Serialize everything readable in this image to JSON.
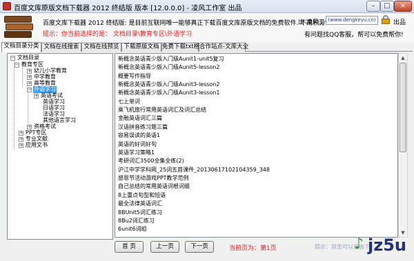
{
  "window": {
    "title": "百度文库原版文档下载器 2012 终结版    版本 [12.0.0.0]  - 凌风工作室 出品",
    "buttons": {
      "minimize": "–",
      "maximize": "□",
      "close": "×"
    }
  },
  "header": {
    "intro": "百度文库下载器 2012 终结版: 是目前互联网唯一能够真正下载百度文库原版文档的免费软件. 不用积分!",
    "hint_prefix": "提示：你当前选择的是：",
    "hint_value": "文档目录\\教育专区\\外语学习",
    "author": "出 凌风工作室",
    "url": "(www.dengkeyu.cn)",
    "exit": "出品",
    "problem": "有问题找QQ客服，帮可以免费帮你!"
  },
  "tabs": [
    "文档目录分类",
    "文档在线搜索",
    "文档在线预览",
    "下载原版文档",
    "免费下载txt格式",
    "合作站点-文库大全"
  ],
  "active_tab": 0,
  "tree": {
    "root": "文档目录",
    "nodes": [
      {
        "label": "文档目录",
        "expander": "−"
      },
      {
        "label": "教育专区",
        "expander": "−"
      },
      {
        "label": "幼儿小学教育",
        "expander": "+"
      },
      {
        "label": "中学教育",
        "expander": "+"
      },
      {
        "label": "高等教育",
        "expander": "+"
      },
      {
        "label": "外语学习",
        "expander": "−",
        "selected": true
      },
      {
        "label": "英语考试",
        "expander": "+"
      },
      {
        "label": "英语学习",
        "expander": ""
      },
      {
        "label": "日语学习",
        "expander": ""
      },
      {
        "label": "法语学习",
        "expander": ""
      },
      {
        "label": "其他语言学习",
        "expander": ""
      },
      {
        "label": "资格考试",
        "expander": "+"
      },
      {
        "label": "PPT专区",
        "expander": "+"
      },
      {
        "label": "专业文献",
        "expander": "+"
      },
      {
        "label": "应用文书",
        "expander": "+"
      }
    ]
  },
  "list": {
    "items": [
      "新概念英语青少版入门级Aunit1-unit5复习",
      "新概念英语青少版入门级Aunit5-lesson2",
      "概要写作指导",
      "新概念英语青少版入门级Aunit3-lesson2",
      "新概念英语青少版入门级Aunit3-lesson1",
      "七上单词",
      "乘飞机旅行常用英语词汇及词汇总结",
      "金融英语词汇三篇",
      "汉语拼音练习题三篇",
      "容易误读的英语1",
      "英语的好词好句",
      "英语学习策略1",
      "考研词汇3500全集全练(2)",
      "沪江中学学科网_25词五首课件_20130617102104359_348",
      "感恩节活动游戏PPT教学范例",
      "自己总结的常用英语词根词缀",
      "8上重点句型和短语",
      "最全法律英语词汇",
      "8BUnit5词汇练习",
      "8Bu2词汇练习",
      "6unit6词组"
    ]
  },
  "pager": {
    "first": "首  页",
    "prev": "上一页",
    "next": "下一页",
    "page_info": "当前页为：第1页",
    "status": "提示：双击可以自由下"
  },
  "watermark": {
    "glyph": "♪",
    "text": "jz5u"
  },
  "colors": {
    "hint": "#e01f1f",
    "selection": "#3399ff",
    "url": "#1c3a8c"
  }
}
